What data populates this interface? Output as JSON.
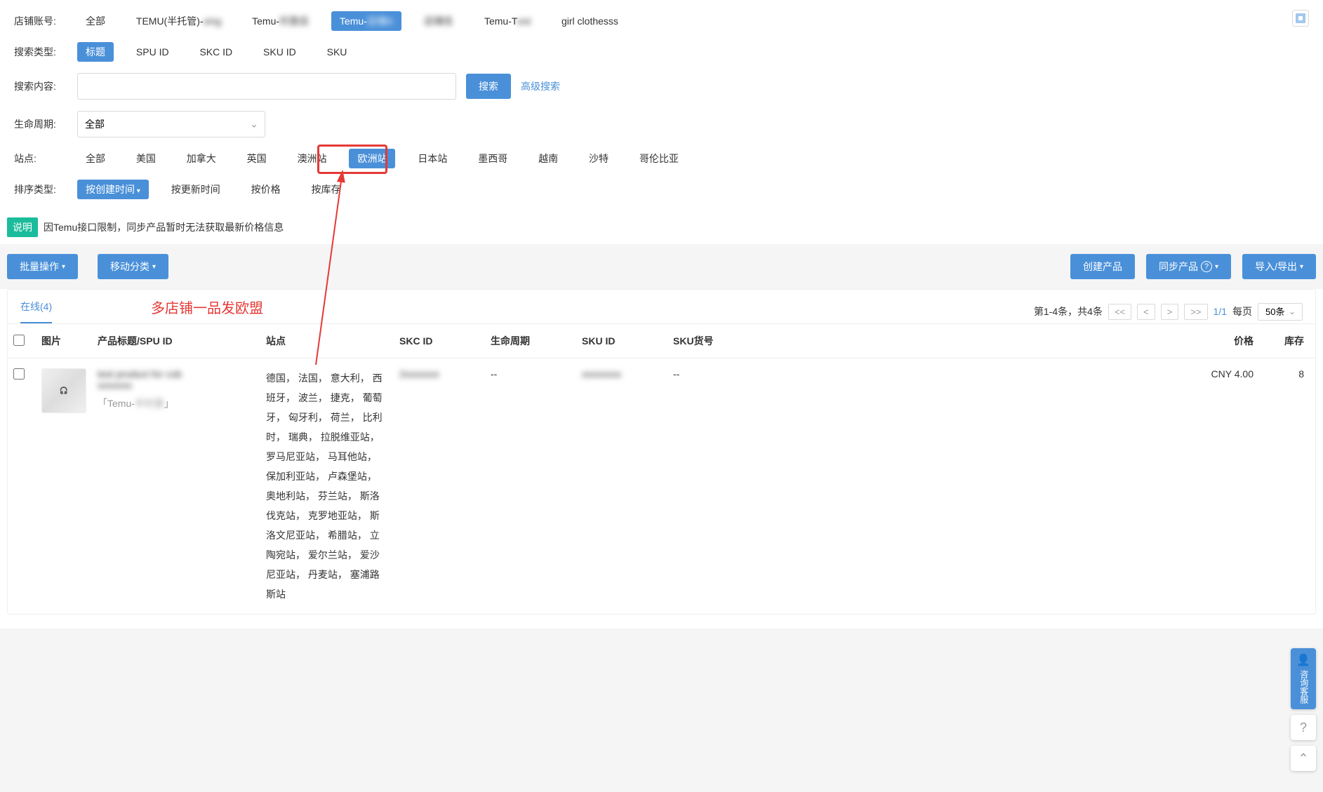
{
  "filters": {
    "shop_label": "店铺账号:",
    "shops": [
      {
        "label": "全部",
        "active": false
      },
      {
        "label": "TEMU(半托管)-",
        "active": false,
        "blur_tail": "xing"
      },
      {
        "label": "Temu-",
        "active": false,
        "blur_tail": "托管店"
      },
      {
        "label": "Temu-",
        "active": true,
        "blur_tail": "店铺A"
      },
      {
        "label": "",
        "active": false,
        "blur_tail": "店铺名"
      },
      {
        "label": "Temu-T",
        "active": false,
        "blur_tail": "est"
      },
      {
        "label": "girl clothesss",
        "active": false
      }
    ],
    "search_type_label": "搜索类型:",
    "search_types": [
      {
        "label": "标题",
        "active": true
      },
      {
        "label": "SPU ID",
        "active": false
      },
      {
        "label": "SKC ID",
        "active": false
      },
      {
        "label": "SKU ID",
        "active": false
      },
      {
        "label": "SKU",
        "active": false
      }
    ],
    "search_content_label": "搜索内容:",
    "search_btn": "搜索",
    "adv_search": "高级搜索",
    "lifecycle_label": "生命周期:",
    "lifecycle_value": "全部",
    "site_label": "站点:",
    "sites": [
      {
        "label": "全部",
        "active": false
      },
      {
        "label": "美国",
        "active": false
      },
      {
        "label": "加拿大",
        "active": false
      },
      {
        "label": "英国",
        "active": false
      },
      {
        "label": "澳洲站",
        "active": false
      },
      {
        "label": "欧洲站",
        "active": true,
        "highlight": true
      },
      {
        "label": "日本站",
        "active": false
      },
      {
        "label": "墨西哥",
        "active": false
      },
      {
        "label": "越南",
        "active": false
      },
      {
        "label": "沙特",
        "active": false
      },
      {
        "label": "哥伦比亚",
        "active": false
      }
    ],
    "sort_label": "排序类型:",
    "sorts": [
      {
        "label": "按创建时间",
        "active": true,
        "arrow": true
      },
      {
        "label": "按更新时间",
        "active": false
      },
      {
        "label": "按价格",
        "active": false
      },
      {
        "label": "按库存",
        "active": false
      }
    ]
  },
  "notice": {
    "tag": "说明",
    "text": "因Temu接口限制，同步产品暂时无法获取最新价格信息"
  },
  "actions": {
    "batch": "批量操作",
    "move": "移动分类",
    "create": "创建产品",
    "sync": "同步产品",
    "import": "导入/导出"
  },
  "annotation": "多店铺一品发欧盟",
  "tabs": {
    "online": "在线(4)"
  },
  "pager": {
    "summary": "第1-4条，共4条",
    "first": "<<",
    "prev": "<",
    "next": ">",
    "last": ">>",
    "page": "1/1",
    "per_label": "每页",
    "size": "50条"
  },
  "table": {
    "headers": {
      "image": "图片",
      "title": "产品标题/SPU ID",
      "site": "站点",
      "skc": "SKC ID",
      "lifecycle": "生命周期",
      "skuid": "SKU ID",
      "skuno": "SKU货号",
      "price": "价格",
      "stock": "库存"
    },
    "rows": [
      {
        "title_blur": "test product for cob",
        "spu_blur": "xxxxxxx",
        "store_prefix": "「Temu-",
        "store_blur": "半托管",
        "store_suffix": "」",
        "sites": "德国， 法国， 意大利， 西班牙， 波兰， 捷克， 葡萄牙， 匈牙利， 荷兰， 比利时， 瑞典， 拉脱维亚站， 罗马尼亚站， 马耳他站， 保加利亚站， 卢森堡站， 奥地利站， 芬兰站， 斯洛伐克站， 克罗地亚站， 斯洛文尼亚站， 希腊站， 立陶宛站， 爱尔兰站， 爱沙尼亚站， 丹麦站， 塞浦路斯站",
        "skc_blur": "2xxxxxxx",
        "lifecycle": "--",
        "skuid_blur": "xxxxxxxx",
        "skuno": "--",
        "price": "CNY 4.00",
        "stock": "8"
      }
    ]
  },
  "side": {
    "cs": "咨询客服"
  }
}
